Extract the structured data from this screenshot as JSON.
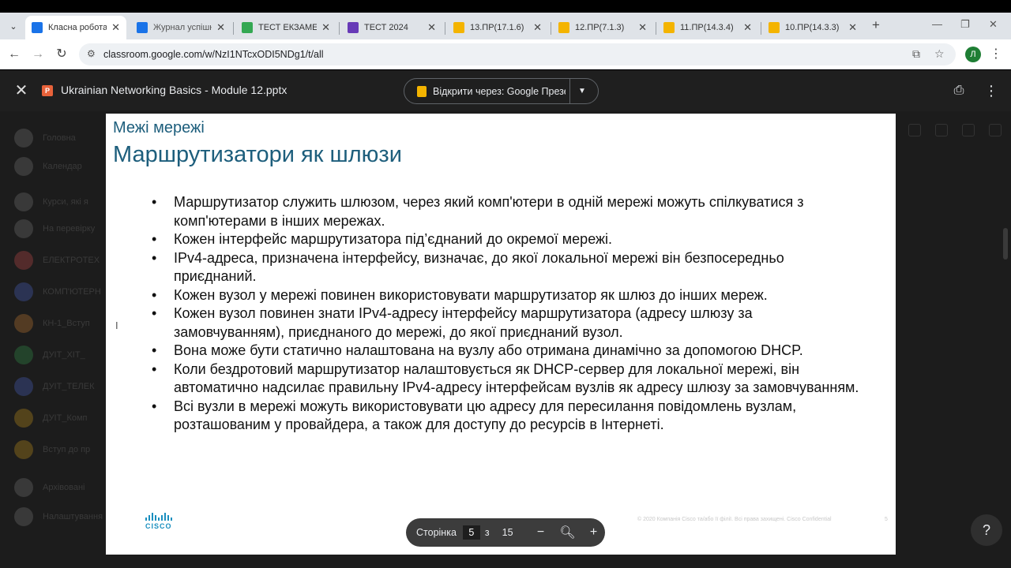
{
  "browser": {
    "tabs": [
      {
        "title": "Класна робота д",
        "active": true,
        "favicon_color": "#1a73e8"
      },
      {
        "title": "Журнал успішно",
        "active": false,
        "favicon_color": "#1a73e8"
      },
      {
        "title": "ТЕСТ ЕКЗАМЕН",
        "active": false,
        "favicon_color": "#34a853"
      },
      {
        "title": "ТЕСТ 2024",
        "active": false,
        "favicon_color": "#673ab7"
      },
      {
        "title": "13.ПР(17.1.6)",
        "active": false,
        "favicon_color": "#f4b400"
      },
      {
        "title": "12.ПР(7.1.3)",
        "active": false,
        "favicon_color": "#f4b400"
      },
      {
        "title": "11.ПР(14.3.4)",
        "active": false,
        "favicon_color": "#f4b400"
      },
      {
        "title": "10.ПР(14.3.3)",
        "active": false,
        "favicon_color": "#f4b400"
      }
    ],
    "url": "classroom.google.com/w/NzI1NTcxODI5NDg1/t/all",
    "profile_initial": "Л"
  },
  "viewer": {
    "file_title": "Ukrainian Networking Basics - Module 12.pptx",
    "open_with_label": "Відкрити через: Google Презентації"
  },
  "slide": {
    "section": "Межі мережі",
    "title": "Маршрутизатори як шлюзи",
    "bullets": [
      "Маршрутизатор служить шлюзом, через який комп'ютери в одній мережі можуть спілкуватися з комп'ютерами в інших мережах.",
      "Кожен інтерфейс маршрутизатора під’єднаний до окремої мережі.",
      "IPv4-адреса, призначена інтерфейсу, визначає, до якої локальної мережі він безпосередньо приєднаний.",
      "Кожен вузол у мережі повинен використовувати маршрутизатор як шлюз до інших мереж.",
      "Кожен вузол повинен знати IPv4-адресу інтерфейсу маршрутизатора (адресу шлюзу за замовчуванням), приєднаного до мережі, до якої приєднаний вузол.",
      "Вона може бути статично налаштована на вузлу або отримана динамічно за допомогою DHCP.",
      "Коли бездротовий маршрутизатор налаштовується як DHCP-сервер для локальної мережі, він автоматично надсилає правильну IPv4-адресу інтерфейсам вузлів як адресу шлюзу за замовчуванням.",
      "Всі вузли в мережі можуть використовувати цю адресу для пересилання повідомлень вузлам, розташованим у провайдера, а також для доступу до ресурсів в Інтернеті."
    ],
    "logo_text": "CISCO",
    "footer": "© 2020 Компанія Cisco та/або її філії. Всі права захищені.   Cisco Confidential",
    "number": "5"
  },
  "pager": {
    "label": "Сторінка",
    "current": "5",
    "of": "з",
    "total": "15"
  },
  "background_sidebar": [
    {
      "label": "Головна",
      "color": "#555"
    },
    {
      "label": "Календар",
      "color": "#555"
    },
    {
      "label": "Курси, які я",
      "color": "#555"
    },
    {
      "label": "На перевірку",
      "color": "#555"
    },
    {
      "label": "ЕЛЕКТРОТЕХ",
      "color": "#8a3a3a"
    },
    {
      "label": "КОМП'ЮТЕРН",
      "color": "#3a4a8a"
    },
    {
      "label": "КН-1_Вступ",
      "color": "#8a5a2a"
    },
    {
      "label": "ДУІТ_ХІТ_",
      "color": "#2a6a3a"
    },
    {
      "label": "ДУІТ_ТЕЛЕК",
      "color": "#3a4a8a"
    },
    {
      "label": "ДУІТ_Комп",
      "color": "#8a6a1a"
    },
    {
      "label": "Вступ до пр",
      "color": "#8a6a1a"
    },
    {
      "label": "Архівовані",
      "color": "#555"
    },
    {
      "label": "Налаштування",
      "color": "#555"
    }
  ]
}
